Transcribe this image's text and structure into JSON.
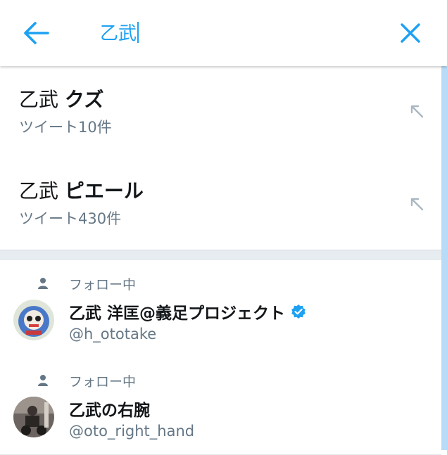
{
  "search": {
    "query": "乙武",
    "back_label": "back",
    "close_label": "clear"
  },
  "suggestions": [
    {
      "prefix": "乙武",
      "highlight": "クズ",
      "count_text": "ツイート10件"
    },
    {
      "prefix": "乙武",
      "highlight": "ピエール",
      "count_text": "ツイート430件"
    }
  ],
  "users": [
    {
      "context": "フォロー中",
      "name": "乙武 洋匡@義足プロジェクト",
      "verified": true,
      "handle": "@h_ototake"
    },
    {
      "context": "フォロー中",
      "name": "乙武の右腕",
      "verified": false,
      "handle": "@oto_right_hand"
    }
  ],
  "colors": {
    "accent": "#1da1f2",
    "secondary_text": "#657786",
    "divider": "#e6ecf0"
  },
  "icons": {
    "back": "arrow-left-icon",
    "close": "close-icon",
    "fill": "arrow-up-left-icon",
    "person": "person-icon",
    "verified": "verified-badge-icon"
  }
}
